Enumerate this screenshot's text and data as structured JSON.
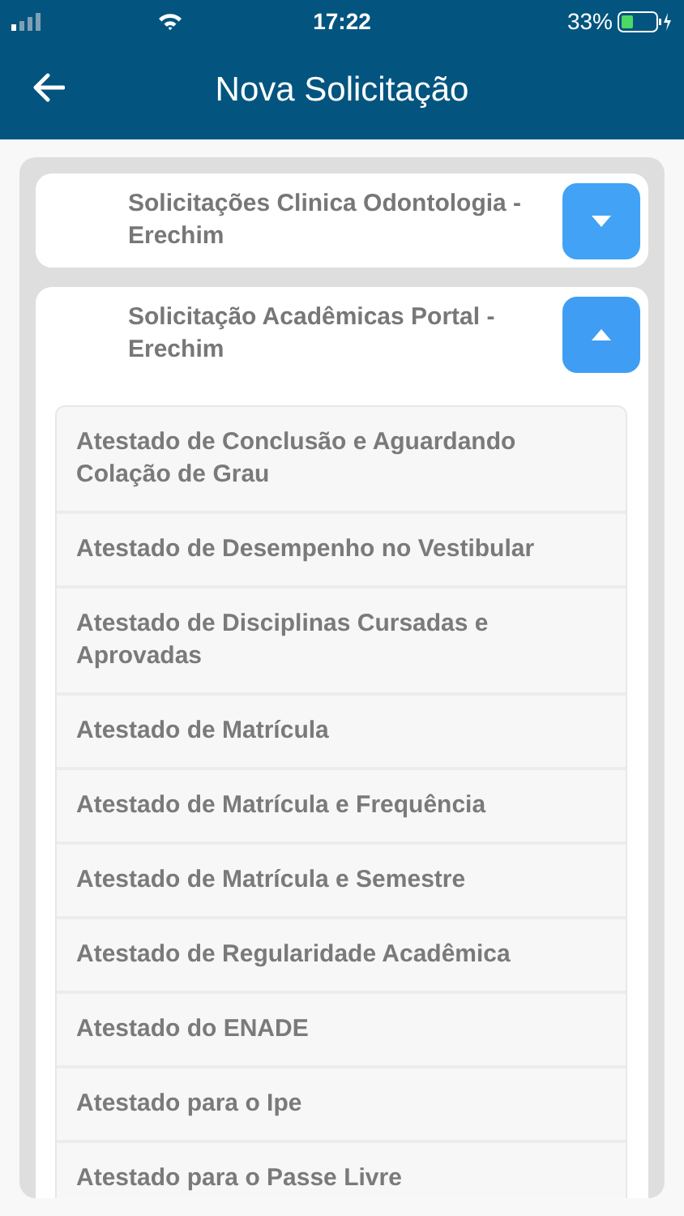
{
  "status_bar": {
    "time": "17:22",
    "battery": "33%"
  },
  "header": {
    "title": "Nova Solicitação"
  },
  "groups": [
    {
      "title": "Solicitações Clinica Odontologia - Erechim",
      "expanded": false
    },
    {
      "title": "Solicitação Acadêmicas Portal - Erechim",
      "expanded": true,
      "items": [
        "Atestado de Conclusão e Aguardando Colação de Grau",
        "Atestado de Desempenho no Vestibular",
        "Atestado de Disciplinas Cursadas e Aprovadas",
        "Atestado de Matrícula",
        "Atestado de Matrícula e Frequência",
        "Atestado de Matrícula e Semestre",
        "Atestado de Regularidade Acadêmica",
        "Atestado do ENADE",
        "Atestado para o Ipe",
        "Atestado para o Passe Livre"
      ]
    }
  ]
}
